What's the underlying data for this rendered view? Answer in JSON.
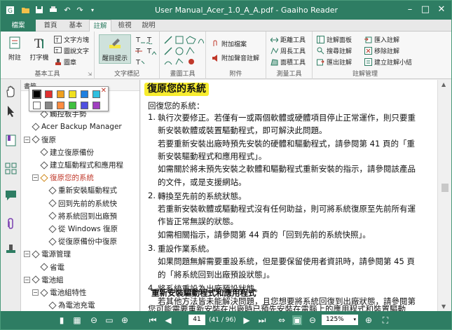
{
  "window": {
    "title": "User Manual_Acer_1.0_A_A.pdf - Gaaiho Reader"
  },
  "tabs": [
    "檔案",
    "首頁",
    "基本",
    "註解",
    "檢視",
    "說明"
  ],
  "ribbon": {
    "basic_tools": {
      "label": "基本工具",
      "attach": "附註",
      "typewriter": "打字機",
      "textbox": "文字方塊",
      "callout": "圖說文字",
      "stamp": "圖章"
    },
    "text_markup": {
      "label": "文字標記",
      "highlight": "醒目提示"
    },
    "drawing": {
      "label": "畫圖工具"
    },
    "attachments": {
      "label": "附件",
      "attach_file": "附加檔案",
      "attach_sound": "附加聲音註解"
    },
    "measure": {
      "label": "測量工具",
      "distance": "距離工具",
      "perimeter": "周長工具",
      "area": "面積工具"
    },
    "manage": {
      "label": "註解管理",
      "panel": "註解面板",
      "search": "搜尋註解",
      "export": "匯出註解",
      "import": "匯入註解",
      "move": "移除註解",
      "summary": "建立註解小結"
    }
  },
  "bookmarks": {
    "header": "書籤",
    "items": [
      {
        "label": "觸控板基本操作",
        "depth": 2
      },
      {
        "label": "觸控板手勢",
        "depth": 2
      },
      {
        "label": "Acer Backup Manager",
        "depth": 1
      },
      {
        "label": "復原",
        "depth": 1,
        "tog": "−"
      },
      {
        "label": "建立復原備份",
        "depth": 2
      },
      {
        "label": "建立驅動程式和應用程",
        "depth": 2
      },
      {
        "label": "復原您的系統",
        "depth": 2,
        "tog": "−",
        "color": "#c0392b"
      },
      {
        "label": "重新安裝驅動程式",
        "depth": 3
      },
      {
        "label": "回到先前的系統快",
        "depth": 3
      },
      {
        "label": "將系統回到出廠預",
        "depth": 3
      },
      {
        "label": "從 Windows 復原",
        "depth": 3
      },
      {
        "label": "從復原備份中復原",
        "depth": 3
      },
      {
        "label": "電源管理",
        "depth": 1,
        "tog": "−"
      },
      {
        "label": "省電",
        "depth": 2
      },
      {
        "label": "電池組",
        "depth": 1,
        "tog": "−"
      },
      {
        "label": "電池組特性",
        "depth": 2,
        "tog": "−"
      },
      {
        "label": "為電池充電",
        "depth": 3
      }
    ]
  },
  "palette": {
    "colors": [
      "#000000",
      "#e03030",
      "#f0a020",
      "#f0e020",
      "#2080e0",
      "#30c0e0",
      "#ffffff",
      "#888888",
      "#ff8c40",
      "#40c040",
      "#5050e0",
      "#a040c0"
    ]
  },
  "document": {
    "heading": "復原您的系統",
    "intro": "回復您的系統：",
    "items": [
      {
        "n": "1.",
        "lines": [
          "執行次要修正。若僅有一或兩個軟體或硬體項目停止正常運作，則只要重",
          "新安裝軟體或裝置驅動程式，即可解決此問題。",
          "若要重新安裝出廠時預先安裝的硬體和驅動程式，請參閱第 41 頁的「重",
          "新安裝驅動程式和應用程式」。",
          "如需關於將未預先安裝之軟體和驅動程式重新安裝的指示，請參閱該產品",
          "的文件，或是支援網站。"
        ]
      },
      {
        "n": "2.",
        "lines": [
          "轉換至先前的系統狀態。",
          "若重新安裝軟體或驅動程式沒有任何助益，則可將系統復原至先前所有運",
          "作皆正常無誤的狀態。",
          "如需相關指示，請參閱第 44 頁的「回到先前的系統快照」。"
        ]
      },
      {
        "n": "3.",
        "lines": [
          "重設作業系統。",
          "如果問題無解需要重設系統，但是要保留使用者資訊時，請參閱第 45 頁",
          "的「將系統回到出廠預設狀態」。"
        ]
      },
      {
        "n": "4.",
        "lines": [
          "將系統重設為出廠預設狀態。",
          "若其他方法皆未能解決問題，且您想要將系統回復到出廠狀態，請參閱第",
          "45 頁的「將系統回到出廠預設狀態」。"
        ]
      }
    ],
    "subheading": "重新安裝驅動程式和應用程式",
    "trailing": "您可能需要重新安裝在出廠時已預先安裝在電腦上的應用程式和裝置驅動"
  },
  "status": {
    "page": "41",
    "page_of": "(41 / 96)",
    "zoom": "125%"
  }
}
